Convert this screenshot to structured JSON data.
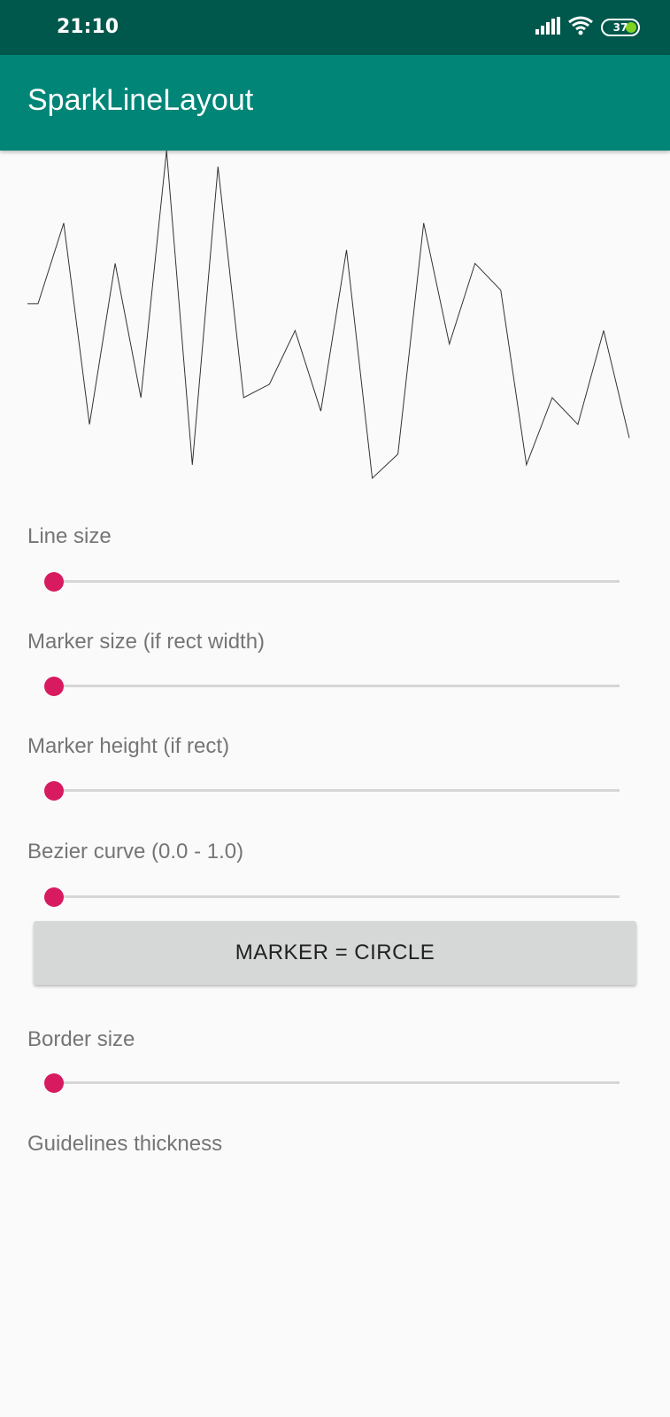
{
  "status_bar": {
    "time": "21:10",
    "battery_level": "37",
    "icons": [
      "signal-icon",
      "wifi-icon",
      "battery-icon"
    ]
  },
  "app_bar": {
    "title": "SparkLineLayout"
  },
  "sparkline": {
    "values": [
      60,
      90,
      15,
      75,
      25,
      117,
      0,
      111,
      25,
      30,
      50,
      20,
      80,
      -5,
      4,
      90,
      45,
      75,
      65,
      0,
      25,
      15,
      50,
      10
    ],
    "line_color": "#333333"
  },
  "controls": {
    "line_size": {
      "label": "Line size",
      "value": 0
    },
    "marker_size": {
      "label": "Marker size (if rect width)",
      "value": 0
    },
    "marker_height": {
      "label": "Marker height (if rect)",
      "value": 0
    },
    "bezier_curve": {
      "label": "Bezier curve (0.0 - 1.0)",
      "value": 0
    },
    "marker_button": {
      "label": "MARKER = CIRCLE"
    },
    "border_size": {
      "label": "Border size",
      "value": 0
    },
    "guidelines_thickness": {
      "label": "Guidelines thickness"
    }
  },
  "colors": {
    "status_bar": "#00574b",
    "app_bar": "#008577",
    "accent": "#d81b60",
    "background": "#fafafa"
  }
}
